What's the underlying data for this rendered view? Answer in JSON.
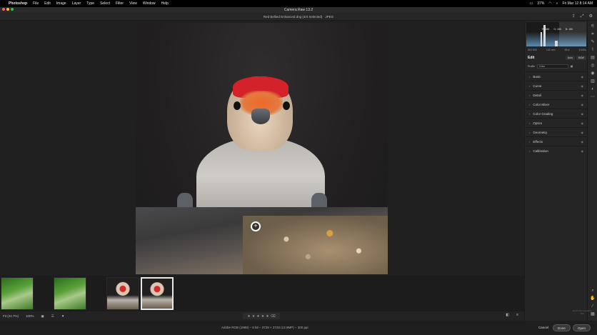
{
  "menubar": {
    "app": "Photoshop",
    "items": [
      "File",
      "Edit",
      "Image",
      "Layer",
      "Type",
      "Select",
      "Filter",
      "View",
      "Window",
      "Help"
    ],
    "battery": "37%",
    "clock": "Fri Mar 12  8:14 AM"
  },
  "window": {
    "title": "Camera Raw 13.2",
    "file_label": "Red Bellied Enhanced.dng (4/4 Selected)  ·  JPEG"
  },
  "histogram": {
    "r": "R: 186",
    "g": "G: 186",
    "b": "B: 186"
  },
  "camera_info": [
    "ISO 800",
    "140 mm",
    "f/5.6",
    "1/160s"
  ],
  "edit": {
    "title": "Edit",
    "auto_label": "Auto",
    "bw_label": "B&W",
    "profile_label": "Profile",
    "profile_value": "Color"
  },
  "sections": [
    "Basic",
    "Curve",
    "Detail",
    "Color Mixer",
    "Color Grading",
    "Optics",
    "Geometry",
    "Effects",
    "Calibration"
  ],
  "bottom": {
    "zoom_fit": "Fit (22.7%)",
    "zoom_pct": "100%",
    "info": "Adobe RGB (1998) – 8 bit – 3728 × 3728 (13.9MP) – 300 ppi"
  },
  "buttons": {
    "cancel": "Cancel",
    "done": "Done",
    "open": "Open"
  },
  "watermark": "Scott's Photography Tips"
}
